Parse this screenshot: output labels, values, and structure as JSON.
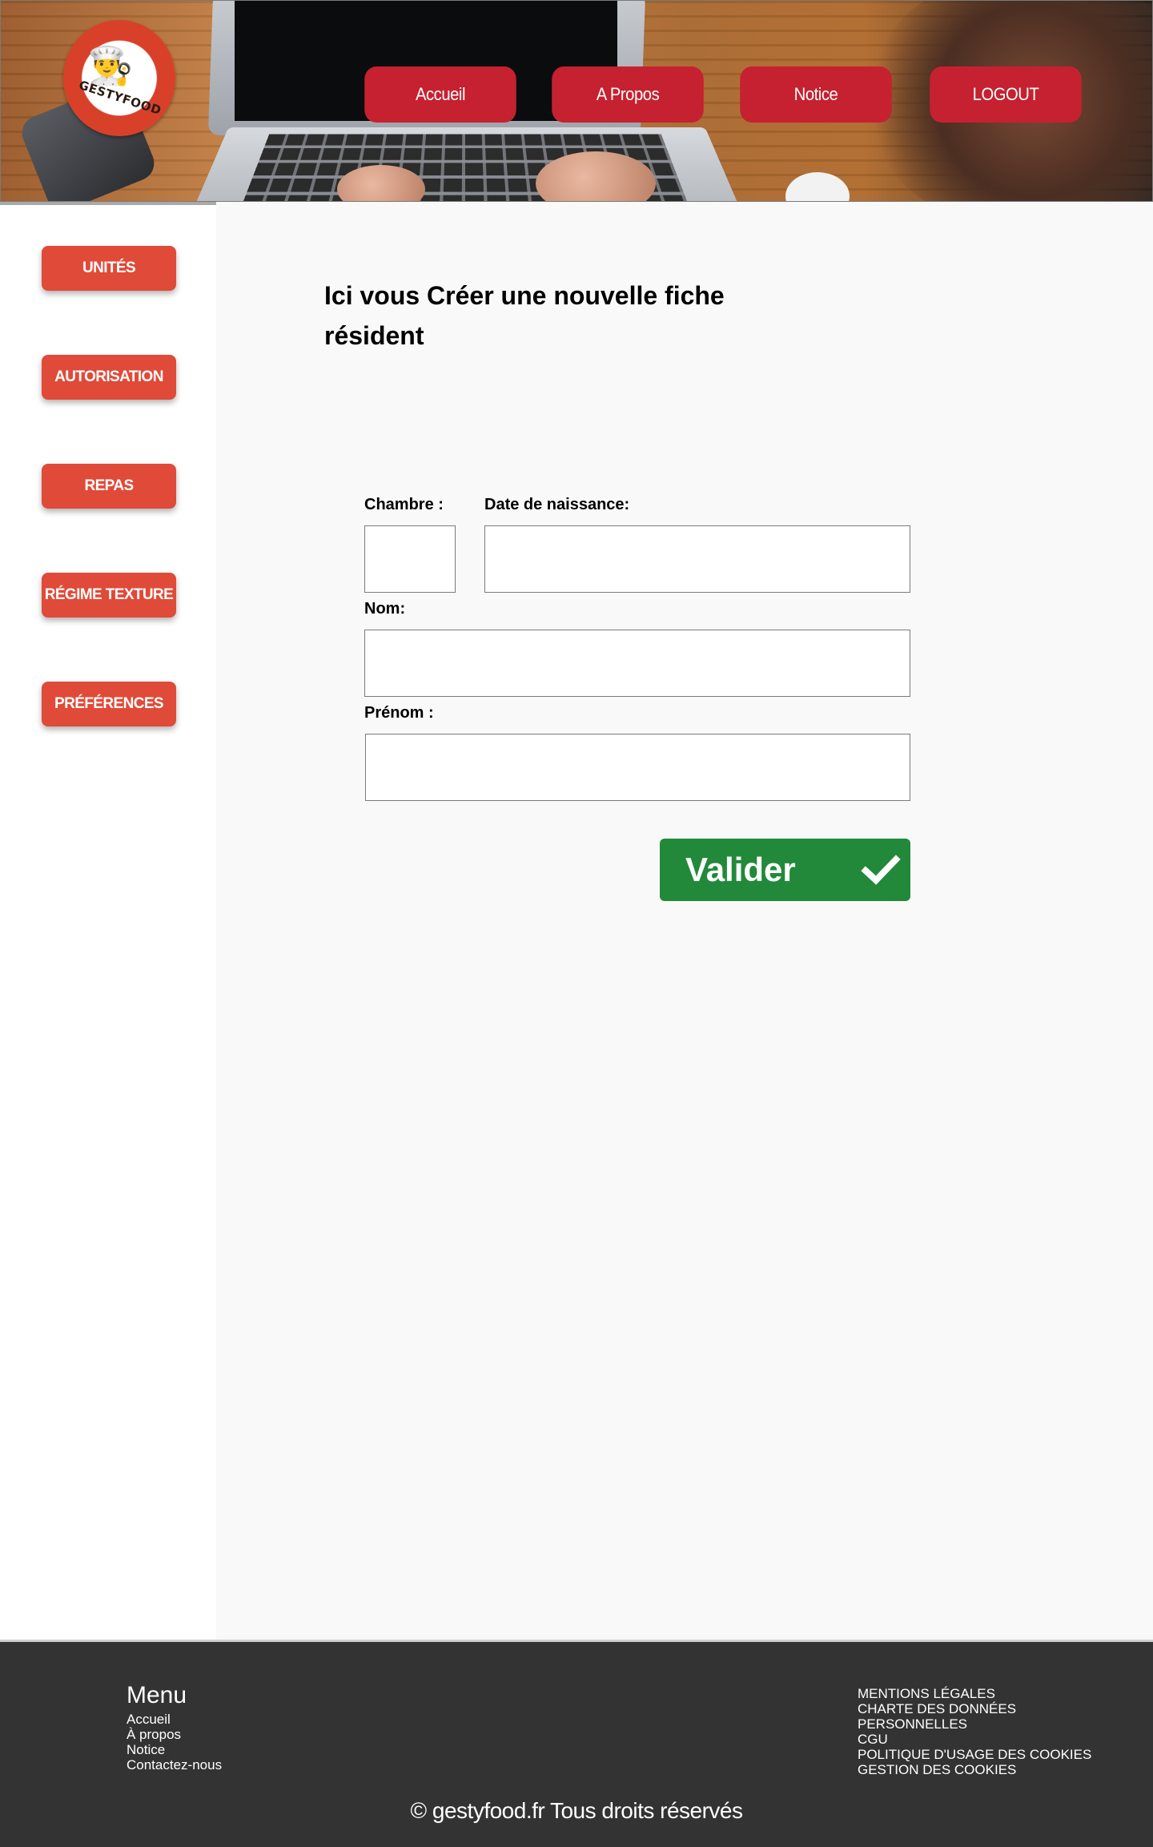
{
  "header": {
    "logo_text": "GESTYFOOD",
    "nav": {
      "accueil": "Accueil",
      "apropos": "A Propos",
      "notice": "Notice",
      "logout": "LOGOUT"
    }
  },
  "sidebar": {
    "items": [
      {
        "label": "UNITÉS"
      },
      {
        "label": "AUTORISATION"
      },
      {
        "label": "REPAS"
      },
      {
        "label": "RÉGIME TEXTURE"
      },
      {
        "label": "PRÉFÉRENCES"
      }
    ]
  },
  "main": {
    "title": "Ici vous  Créer une nouvelle  fiche résident",
    "form": {
      "chambre": {
        "label": "Chambre :",
        "value": ""
      },
      "date_naissance": {
        "label": "Date de naissance:",
        "value": ""
      },
      "nom": {
        "label": "Nom:",
        "value": ""
      },
      "prenom": {
        "label": "Prénom :",
        "value": ""
      },
      "submit": {
        "label": "Valider",
        "icon": "check-icon"
      }
    }
  },
  "footer": {
    "menu_title": "Menu",
    "menu_links": [
      "Accueil",
      "À propos",
      "Notice",
      "Contactez-nous"
    ],
    "legal_links": [
      "MENTIONS LÉGALES",
      "CHARTE DES DONNÉES",
      "PERSONNELLES",
      "CGU",
      "POLITIQUE D'USAGE DES COOKIES",
      "GESTION DES COOKIES"
    ],
    "copyright": "© gestyfood.fr  Tous droits réservés"
  },
  "colors": {
    "nav_red": "#c62130",
    "sidebar_red": "#e04a38",
    "submit_green": "#22893a",
    "footer_bg": "#333333"
  }
}
